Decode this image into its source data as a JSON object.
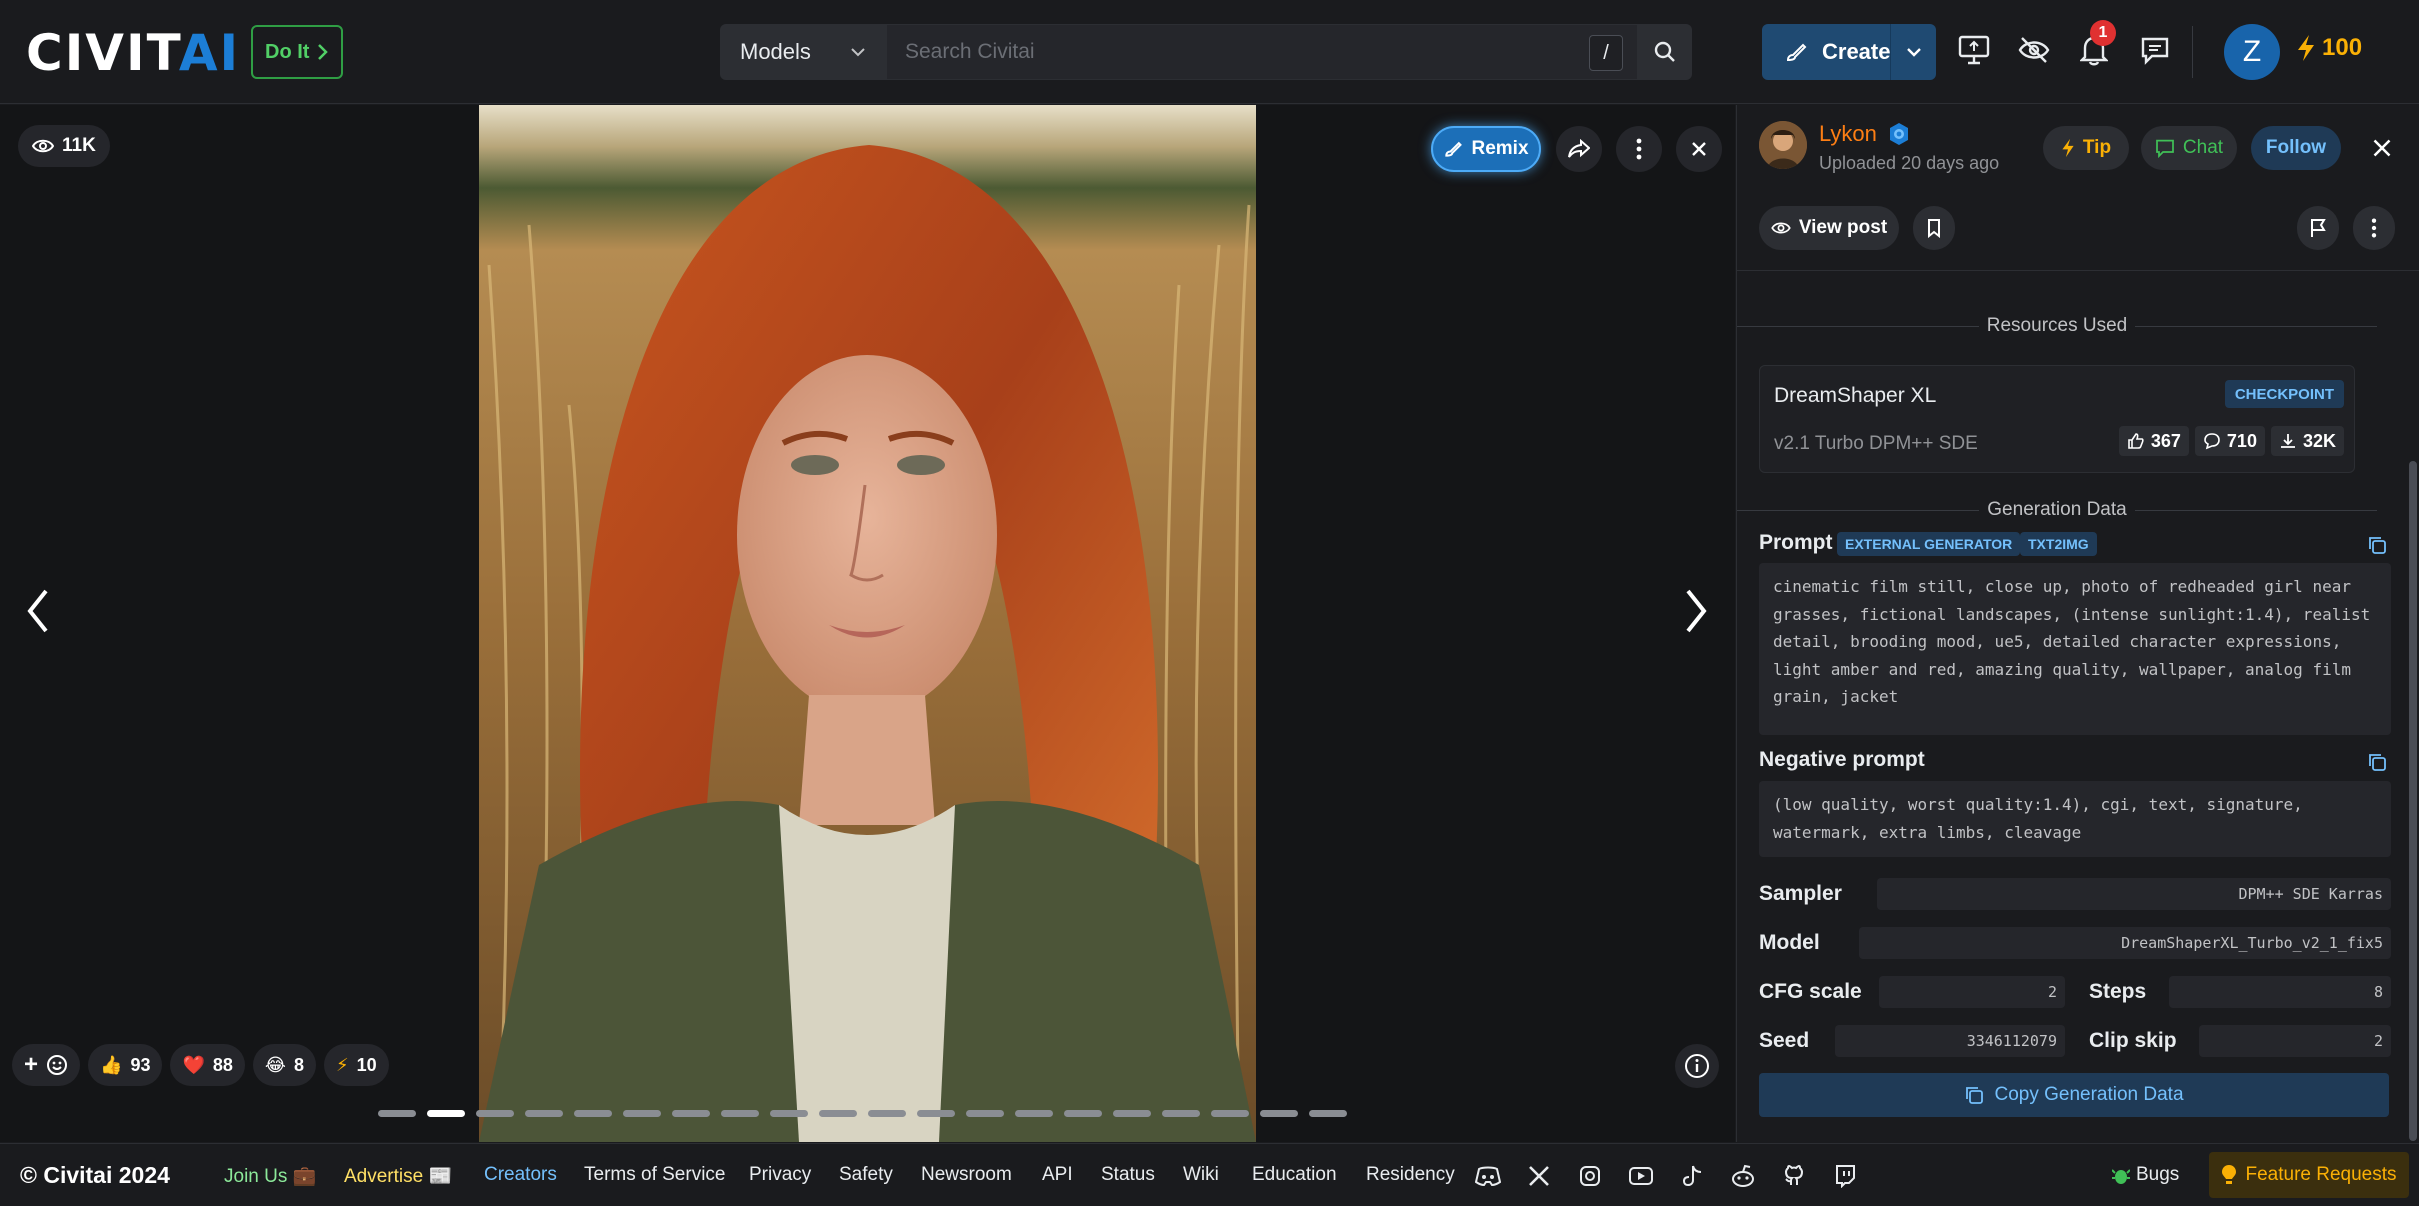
{
  "header": {
    "logo_part1": "CIVIT",
    "logo_part2": "AI",
    "do_it_label": "Do It",
    "search_category": "Models",
    "search_placeholder": "Search Civitai",
    "search_shortcut": "/",
    "create_label": "Create",
    "notification_count": "1",
    "user_initial": "Z",
    "buzz_amount": "100"
  },
  "viewer": {
    "view_count": "11K",
    "remix_label": "Remix",
    "reactions": [
      {
        "icon": "👍",
        "count": "93"
      },
      {
        "icon": "❤️",
        "count": "88"
      },
      {
        "icon": "😂",
        "count": "8"
      },
      {
        "icon": "⚡",
        "count": "10"
      }
    ],
    "page_total": 20,
    "active_page": 2
  },
  "panel": {
    "author": "Lykon",
    "uploaded": "Uploaded 20 days ago",
    "tip_label": "Tip",
    "chat_label": "Chat",
    "follow_label": "Follow",
    "view_post_label": "View post",
    "resources_title": "Resources Used",
    "resource": {
      "name": "DreamShaper XL",
      "badge": "CHECKPOINT",
      "version": "v2.1 Turbo DPM++ SDE",
      "likes": "367",
      "comments": "710",
      "downloads": "32K"
    },
    "generation_title": "Generation Data",
    "prompt_label": "Prompt",
    "prompt_badge_1": "EXTERNAL GENERATOR",
    "prompt_badge_2": "TXT2IMG",
    "prompt_text": "cinematic film still, close up, photo of redheaded girl near grasses, fictional landscapes, (intense sunlight:1.4), realist detail, brooding mood, ue5, detailed character expressions, light amber and red, amazing quality, wallpaper, analog film grain, jacket",
    "negative_label": "Negative prompt",
    "negative_text": "(low quality, worst quality:1.4), cgi, text, signature, watermark, extra limbs, cleavage",
    "sampler_label": "Sampler",
    "sampler_value": "DPM++ SDE Karras",
    "model_label": "Model",
    "model_value": "DreamShaperXL_Turbo_v2_1_fix5",
    "cfg_label": "CFG scale",
    "cfg_value": "2",
    "steps_label": "Steps",
    "steps_value": "8",
    "seed_label": "Seed",
    "seed_value": "3346112079",
    "clip_label": "Clip skip",
    "clip_value": "2",
    "copy_gen_label": "Copy Generation Data"
  },
  "footer": {
    "copyright": "© Civitai 2024",
    "join_us": "Join Us 💼",
    "advertise": "Advertise 📰",
    "creators": "Creators",
    "terms": "Terms of Service",
    "privacy": "Privacy",
    "safety": "Safety",
    "newsroom": "Newsroom",
    "api": "API",
    "status": "Status",
    "wiki": "Wiki",
    "education": "Education",
    "residency": "Residency",
    "bugs": "Bugs",
    "feature_requests": "Feature Requests"
  },
  "colors": {
    "background": "#1a1b1e",
    "accent_blue": "#1c7ed6",
    "author_orange": "#fd7e14",
    "buzz_yellow": "#fab005",
    "do_it_green": "#51cf66"
  }
}
